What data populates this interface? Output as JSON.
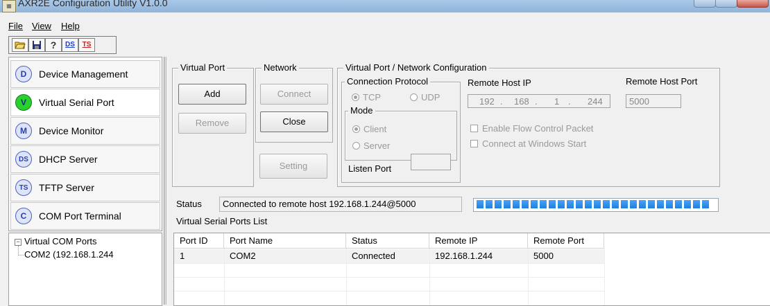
{
  "window": {
    "title": "AXR2E Configuration Utility V1.0.0"
  },
  "menu": {
    "file": "File",
    "view": "View",
    "help": "Help"
  },
  "toolbar": {
    "ds_label": "DS",
    "ts_label": "TS"
  },
  "nav": [
    {
      "badge": "D",
      "label": "Device Management"
    },
    {
      "badge": "V",
      "label": "Virtual Serial Port"
    },
    {
      "badge": "M",
      "label": "Device Monitor"
    },
    {
      "badge": "DS",
      "label": "DHCP Server"
    },
    {
      "badge": "TS",
      "label": "TFTP Server"
    },
    {
      "badge": "C",
      "label": "COM Port Terminal"
    }
  ],
  "tree": {
    "root": "Virtual COM Ports",
    "child": "COM2 (192.168.1.244",
    "expander": "−"
  },
  "virtual_port": {
    "title": "Virtual Port",
    "add": "Add",
    "remove": "Remove"
  },
  "network": {
    "title": "Network",
    "connect": "Connect",
    "close": "Close",
    "setting": "Setting"
  },
  "config": {
    "title": "Virtual Port / Network Configuration",
    "protocol_title": "Connection Protocol",
    "tcp": "TCP",
    "udp": "UDP",
    "mode_title": "Mode",
    "client": "Client",
    "server": "Server",
    "listen_port": "Listen Port",
    "remote_ip_label": "Remote Host IP",
    "remote_ip": [
      "192",
      "168",
      "1",
      "244"
    ],
    "remote_port_label": "Remote Host Port",
    "remote_port": "5000",
    "flow_control": "Enable Flow Control Packet",
    "connect_at_start": "Connect at Windows Start"
  },
  "status": {
    "label": "Status",
    "text": "Connected to remote host 192.168.1.244@5000",
    "progress": 1.0
  },
  "list": {
    "title": "Virtual Serial Ports List",
    "columns": [
      "Port ID",
      "Port Name",
      "Status",
      "Remote IP",
      "Remote Port"
    ],
    "rows": [
      [
        "1",
        "COM2",
        "Connected",
        "192.168.1.244",
        "5000"
      ]
    ]
  },
  "colors": {
    "accent": "#1e7fe0",
    "status_green": "#29d12f"
  }
}
